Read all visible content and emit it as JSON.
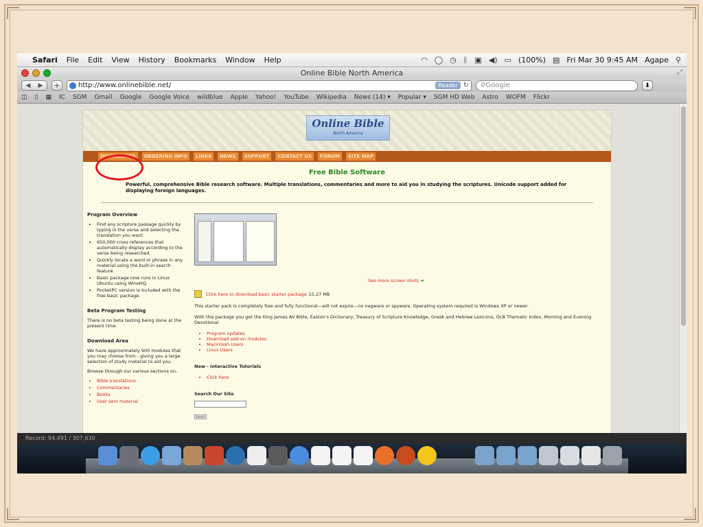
{
  "menubar": {
    "app": "Safari",
    "items": [
      "File",
      "Edit",
      "View",
      "History",
      "Bookmarks",
      "Window",
      "Help"
    ],
    "battery": "(100%)",
    "clock": "Fri Mar 30  9:45 AM",
    "user": "Agape"
  },
  "window": {
    "title": "Online Bible North America"
  },
  "toolbar": {
    "url": "http://www.onlinebible.net/",
    "reader_label": "Reader",
    "search_placeholder": "Google"
  },
  "bookmarks": [
    "IC",
    "SGM",
    "Gmail",
    "Google",
    "Google Voice",
    "wildblue",
    "Apple",
    "Yahoo!",
    "YouTube",
    "Wikipedia",
    "News (14) ▾",
    "Popular ▾",
    "SGM HD Web",
    "Astro",
    "WOFM",
    "Flickr"
  ],
  "site": {
    "logo_title": "Online Bible",
    "logo_sub": "North America",
    "nav": [
      "DOWNLOADS",
      "ORDERING INFO",
      "LINKS",
      "NEWS",
      "SUPPORT",
      "CONTACT US",
      "FORUM",
      "SITE MAP"
    ],
    "headline": "Free Bible Software",
    "intro": "Powerful, comprehensive Bible research software. Multiple translations, commentaries and more to aid you in studying the scriptures. Unicode support added for displaying foreign languages.",
    "left": {
      "overview_title": "Program Overview",
      "overview_items": [
        "Find any scripture passage quickly by typing in the verse and selecting the translation you want.",
        "650,000 cross references that automatically display according to the verse being researched.",
        "Quickly locate a word or phrase in any material using the built-in search feature.",
        "Basic package now runs in Linux Ubuntu using WineHQ.",
        "PocketPC version is included with the free basic package."
      ],
      "beta_title": "Beta Program Testing",
      "beta_text": "There is no beta testing being done at the present time.",
      "download_title": "Download Area",
      "download_text": "We have approximately 900 modules that you may choose from - giving you a large selection of study material to aid you.",
      "browse_text": "Browse through our various sections on-",
      "download_links": [
        "Bible translations",
        "Commentaries",
        "Books",
        "User sent material"
      ]
    },
    "main": {
      "see_more": "See more screen shots",
      "download_link": "Click here to download basic starter package",
      "download_size": "15.27 MB",
      "starter_text": "This starter pack is completely free and fully functional—will not expire—no nagware or spyware. Operating system required is Windows XP or newer.",
      "package_text": "With this package you get the King James AV Bible, Easton's Dictionary, Treasury of Scripture Knowledge, Greek and Hebrew Lexicons, OLB Thematic Index, Morning and Evening Devotional.",
      "links": [
        "Program updates",
        "Download add-on modules",
        "Macintosh Users",
        "Linux Users"
      ],
      "tutorials_title": "New - Interactive Tutorials",
      "tutorials_link": "Click here",
      "search_title": "Search Our Site",
      "search_button": "Search"
    }
  },
  "status": "Record: 94,491 / 307,630",
  "dock_icons": [
    "finder-icon",
    "launchpad-icon",
    "safari-icon",
    "mail-icon",
    "contacts-icon",
    "ical-icon",
    "quicktime-icon",
    "preview-icon",
    "iphoto-icon",
    "itunes-icon",
    "pdf-icon",
    "pages-icon",
    "x11-icon",
    "firefox-icon",
    "thunderbird-icon",
    "yahoo-messenger-icon",
    "folder-icon",
    "downloads-icon",
    "documents-icon",
    "trash-icon"
  ],
  "colors": {
    "nav_bar": "#b4581b",
    "headline": "#2b8a22",
    "link_red": "#d5201a",
    "highlight_circle": "#e8121e"
  }
}
